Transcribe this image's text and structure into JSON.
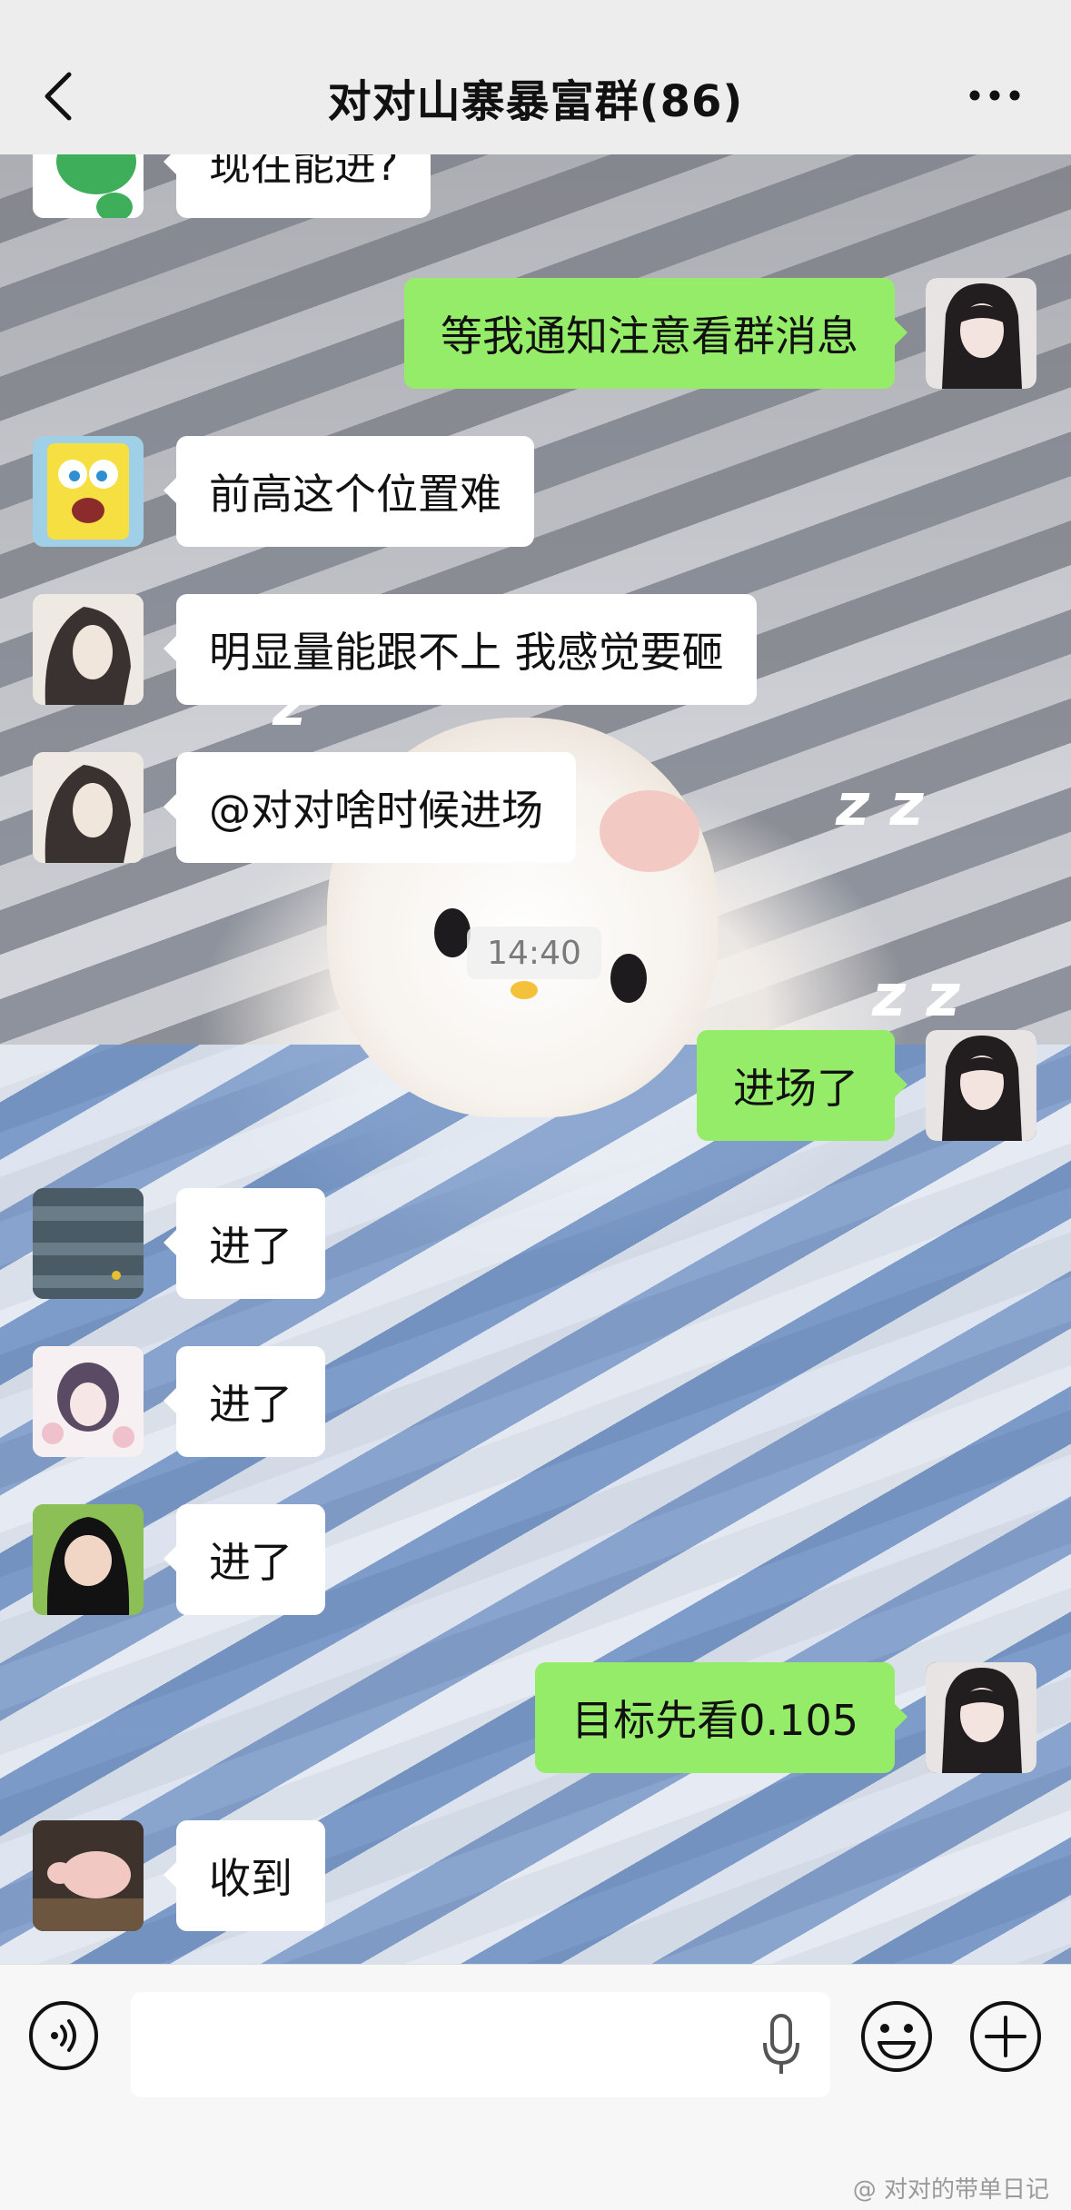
{
  "header": {
    "title": "对对山寨暴富群(86)"
  },
  "timestamp": "14:40",
  "messages": [
    {
      "side": "left",
      "text": "现在能进?",
      "avatar": "green-dinosaur-avatar"
    },
    {
      "side": "right",
      "text": "等我通知注意看群消息",
      "avatar": "girl-long-hair-avatar"
    },
    {
      "side": "left",
      "text": "前高这个位置难",
      "avatar": "spongebob-avatar"
    },
    {
      "side": "left",
      "text": "明显量能跟不上 我感觉要砸",
      "avatar": "anime-boy-avatar"
    },
    {
      "side": "left",
      "text": "@对对啥时候进场",
      "avatar": "anime-boy-avatar"
    },
    {
      "side": "right",
      "text": "进场了",
      "avatar": "girl-long-hair-avatar"
    },
    {
      "side": "left",
      "text": "进了",
      "avatar": "dark-leaf-avatar"
    },
    {
      "side": "left",
      "text": "进了",
      "avatar": "anime-girl-flowers-avatar"
    },
    {
      "side": "left",
      "text": "进了",
      "avatar": "child-black-hood-avatar"
    },
    {
      "side": "right",
      "text": "目标先看0.105",
      "avatar": "girl-long-hair-avatar"
    },
    {
      "side": "left",
      "text": "收到",
      "avatar": "piglet-avatar"
    }
  ],
  "input": {
    "value": "",
    "placeholder": ""
  },
  "icons": {
    "back": "chevron-left-icon",
    "more": "more-dots-icon",
    "voice": "voice-mode-icon",
    "mic": "microphone-icon",
    "emoji": "emoji-icon",
    "plus": "plus-icon"
  },
  "colors": {
    "self_bubble": "#95ec69",
    "other_bubble": "#ffffff",
    "header_bg": "#ededed"
  },
  "watermark": "@ 对对的带单日记"
}
